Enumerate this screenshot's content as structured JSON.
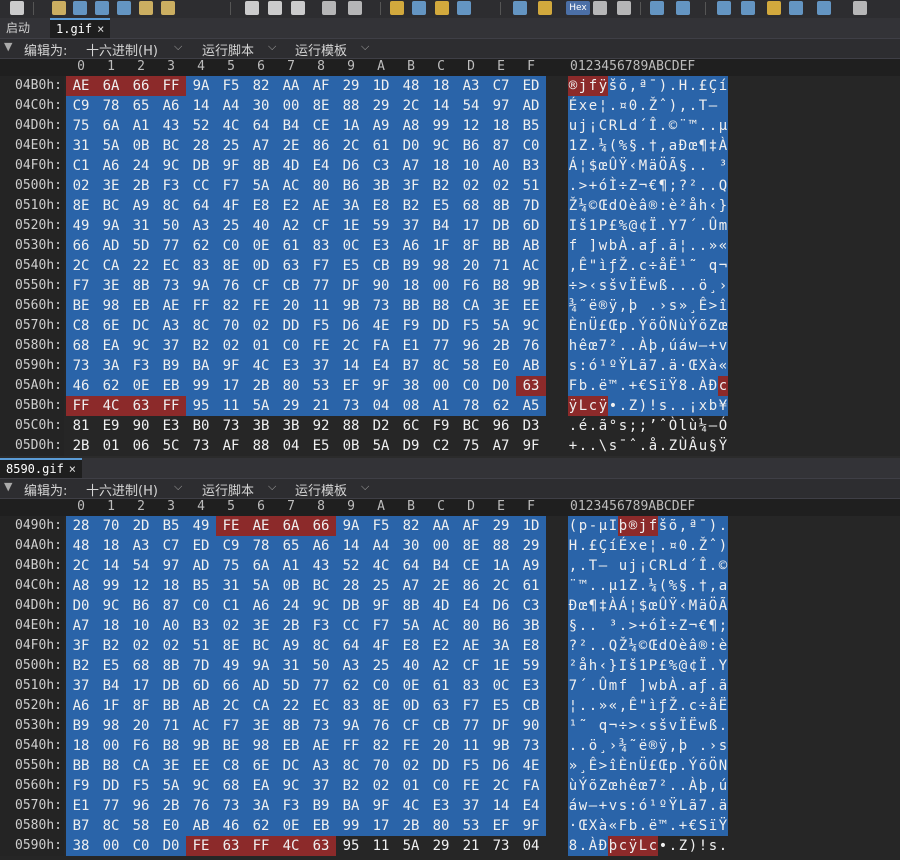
{
  "toolbar": {
    "icons": [
      "new-file-icon",
      "open-folder-icon",
      "save-icon",
      "save-as-icon",
      "save-all-icon",
      "folder-icon",
      "open-multiple-icon",
      "cut-icon",
      "copy-icon",
      "paste-icon",
      "undo-icon",
      "redo-icon",
      "find-icon",
      "replace-icon",
      "find-next-icon",
      "arrow-right-icon",
      "font-icon",
      "highlight-icon",
      "hex-icon",
      "word-wrap-icon",
      "paragraph-icon",
      "list-icon",
      "columns-icon",
      "calculator-icon",
      "settings-icon",
      "tools-icon",
      "chart-icon",
      "convert-icon",
      "expand-icon"
    ],
    "hex_label": "Hex"
  },
  "pane1": {
    "tabs": [
      {
        "label": "启动",
        "active": false
      },
      {
        "label": "1.gif",
        "active": true
      }
    ],
    "close_glyph": "×",
    "toolbar": {
      "edit_as": "编辑为:",
      "edit_mode": "十六进制(H)",
      "run_script": "运行脚本",
      "run_template": "运行模板"
    },
    "col_headers": [
      "0",
      "1",
      "2",
      "3",
      "4",
      "5",
      "6",
      "7",
      "8",
      "9",
      "A",
      "B",
      "C",
      "D",
      "E",
      "F"
    ],
    "ascii_header": "0123456789ABCDEF",
    "rows": [
      {
        "addr": "04B0h:",
        "bytes": [
          "AE",
          "6A",
          "66",
          "FF",
          "9A",
          "F5",
          "82",
          "AA",
          "AF",
          "29",
          "1D",
          "48",
          "18",
          "A3",
          "C7",
          "ED"
        ],
        "ascii": "®jfÿšõ‚ª¯).H.£Çí"
      },
      {
        "addr": "04C0h:",
        "bytes": [
          "C9",
          "78",
          "65",
          "A6",
          "14",
          "A4",
          "30",
          "00",
          "8E",
          "88",
          "29",
          "2C",
          "14",
          "54",
          "97",
          "AD"
        ],
        "ascii": "Éxe¦.¤0.Žˆ),.T—­"
      },
      {
        "addr": "04D0h:",
        "bytes": [
          "75",
          "6A",
          "A1",
          "43",
          "52",
          "4C",
          "64",
          "B4",
          "CE",
          "1A",
          "A9",
          "A8",
          "99",
          "12",
          "18",
          "B5"
        ],
        "ascii": "uj¡CRLd´Î.©¨™..µ"
      },
      {
        "addr": "04E0h:",
        "bytes": [
          "31",
          "5A",
          "0B",
          "BC",
          "28",
          "25",
          "A7",
          "2E",
          "86",
          "2C",
          "61",
          "D0",
          "9C",
          "B6",
          "87",
          "C0"
        ],
        "ascii": "1Z.¼(%§.†,aÐœ¶‡À"
      },
      {
        "addr": "04F0h:",
        "bytes": [
          "C1",
          "A6",
          "24",
          "9C",
          "DB",
          "9F",
          "8B",
          "4D",
          "E4",
          "D6",
          "C3",
          "A7",
          "18",
          "10",
          "A0",
          "B3"
        ],
        "ascii": "Á¦$œÛŸ‹MäÖÃ§.. ³"
      },
      {
        "addr": "0500h:",
        "bytes": [
          "02",
          "3E",
          "2B",
          "F3",
          "CC",
          "F7",
          "5A",
          "AC",
          "80",
          "B6",
          "3B",
          "3F",
          "B2",
          "02",
          "02",
          "51"
        ],
        "ascii": ".>+óÌ÷Z¬€¶;?²..Q"
      },
      {
        "addr": "0510h:",
        "bytes": [
          "8E",
          "BC",
          "A9",
          "8C",
          "64",
          "4F",
          "E8",
          "E2",
          "AE",
          "3A",
          "E8",
          "B2",
          "E5",
          "68",
          "8B",
          "7D"
        ],
        "ascii": "Ž¼©ŒdOèâ®:è²åh‹}"
      },
      {
        "addr": "0520h:",
        "bytes": [
          "49",
          "9A",
          "31",
          "50",
          "A3",
          "25",
          "40",
          "A2",
          "CF",
          "1E",
          "59",
          "37",
          "B4",
          "17",
          "DB",
          "6D"
        ],
        "ascii": "Iš1P£%@¢Ï.Y7´.Ûm"
      },
      {
        "addr": "0530h:",
        "bytes": [
          "66",
          "AD",
          "5D",
          "77",
          "62",
          "C0",
          "0E",
          "61",
          "83",
          "0C",
          "E3",
          "A6",
          "1F",
          "8F",
          "BB",
          "AB"
        ],
        "ascii": "f­]wbÀ.aƒ.ã¦..»«"
      },
      {
        "addr": "0540h:",
        "bytes": [
          "2C",
          "CA",
          "22",
          "EC",
          "83",
          "8E",
          "0D",
          "63",
          "F7",
          "E5",
          "CB",
          "B9",
          "98",
          "20",
          "71",
          "AC"
        ],
        "ascii": ",Ê\"ìƒŽ.c÷åË¹˜ q¬"
      },
      {
        "addr": "0550h:",
        "bytes": [
          "F7",
          "3E",
          "8B",
          "73",
          "9A",
          "76",
          "CF",
          "CB",
          "77",
          "DF",
          "90",
          "18",
          "00",
          "F6",
          "B8",
          "9B"
        ],
        "ascii": "÷>‹sšvÏËwß...ö¸›"
      },
      {
        "addr": "0560h:",
        "bytes": [
          "BE",
          "98",
          "EB",
          "AE",
          "FF",
          "82",
          "FE",
          "20",
          "11",
          "9B",
          "73",
          "BB",
          "B8",
          "CA",
          "3E",
          "EE"
        ],
        "ascii": "¾˜ë®ÿ‚þ .›s»¸Ê>î"
      },
      {
        "addr": "0570h:",
        "bytes": [
          "C8",
          "6E",
          "DC",
          "A3",
          "8C",
          "70",
          "02",
          "DD",
          "F5",
          "D6",
          "4E",
          "F9",
          "DD",
          "F5",
          "5A",
          "9C"
        ],
        "ascii": "ÈnÜ£Œp.ÝõÖNùÝõZœ"
      },
      {
        "addr": "0580h:",
        "bytes": [
          "68",
          "EA",
          "9C",
          "37",
          "B2",
          "02",
          "01",
          "C0",
          "FE",
          "2C",
          "FA",
          "E1",
          "77",
          "96",
          "2B",
          "76"
        ],
        "ascii": "hêœ7²..Àþ,úáw–+v"
      },
      {
        "addr": "0590h:",
        "bytes": [
          "73",
          "3A",
          "F3",
          "B9",
          "BA",
          "9F",
          "4C",
          "E3",
          "37",
          "14",
          "E4",
          "B7",
          "8C",
          "58",
          "E0",
          "AB"
        ],
        "ascii": "s:ó¹ºŸLã7.ä·ŒXà«"
      },
      {
        "addr": "05A0h:",
        "bytes": [
          "46",
          "62",
          "0E",
          "EB",
          "99",
          "17",
          "2B",
          "80",
          "53",
          "EF",
          "9F",
          "38",
          "00",
          "C0",
          "D0",
          "63"
        ],
        "ascii": "Fb.ë™.+€SïŸ8.ÀÐc"
      },
      {
        "addr": "05B0h:",
        "bytes": [
          "FF",
          "4C",
          "63",
          "FF",
          "95",
          "11",
          "5A",
          "29",
          "21",
          "73",
          "04",
          "08",
          "A1",
          "78",
          "62",
          "A5"
        ],
        "ascii": "ÿLcÿ•.Z)!s..¡xb¥"
      },
      {
        "addr": "05C0h:",
        "bytes": [
          "81",
          "E9",
          "90",
          "E3",
          "B0",
          "73",
          "3B",
          "3B",
          "92",
          "88",
          "D2",
          "6C",
          "F9",
          "BC",
          "96",
          "D3"
        ],
        "ascii": ".é.ã°s;;’ˆÒlù¼–Ó"
      },
      {
        "addr": "05D0h:",
        "bytes": [
          "2B",
          "01",
          "06",
          "5C",
          "73",
          "AF",
          "88",
          "04",
          "E5",
          "0B",
          "5A",
          "D9",
          "C2",
          "75",
          "A7",
          "9F"
        ],
        "ascii": "+..\\s¯ˆ.å.ZÙÂu§Ÿ"
      }
    ]
  },
  "pane2": {
    "tabs": [
      {
        "label": "8590.gif",
        "active": true
      }
    ],
    "close_glyph": "×",
    "toolbar": {
      "edit_as": "编辑为:",
      "edit_mode": "十六进制(H)",
      "run_script": "运行脚本",
      "run_template": "运行模板"
    },
    "col_headers": [
      "0",
      "1",
      "2",
      "3",
      "4",
      "5",
      "6",
      "7",
      "8",
      "9",
      "A",
      "B",
      "C",
      "D",
      "E",
      "F"
    ],
    "ascii_header": "0123456789ABCDEF",
    "rows": [
      {
        "addr": "0490h:",
        "bytes": [
          "28",
          "70",
          "2D",
          "B5",
          "49",
          "FE",
          "AE",
          "6A",
          "66",
          "9A",
          "F5",
          "82",
          "AA",
          "AF",
          "29",
          "1D"
        ],
        "ascii": "(p-µIþ®jfšõ‚ª¯)."
      },
      {
        "addr": "04A0h:",
        "bytes": [
          "48",
          "18",
          "A3",
          "C7",
          "ED",
          "C9",
          "78",
          "65",
          "A6",
          "14",
          "A4",
          "30",
          "00",
          "8E",
          "88",
          "29"
        ],
        "ascii": "H.£ÇíÉxe¦.¤0.Žˆ)"
      },
      {
        "addr": "04B0h:",
        "bytes": [
          "2C",
          "14",
          "54",
          "97",
          "AD",
          "75",
          "6A",
          "A1",
          "43",
          "52",
          "4C",
          "64",
          "B4",
          "CE",
          "1A",
          "A9"
        ],
        "ascii": ",.T—­uj¡CRLd´Î.©"
      },
      {
        "addr": "04C0h:",
        "bytes": [
          "A8",
          "99",
          "12",
          "18",
          "B5",
          "31",
          "5A",
          "0B",
          "BC",
          "28",
          "25",
          "A7",
          "2E",
          "86",
          "2C",
          "61"
        ],
        "ascii": "¨™..µ1Z.¼(%§.†,a"
      },
      {
        "addr": "04D0h:",
        "bytes": [
          "D0",
          "9C",
          "B6",
          "87",
          "C0",
          "C1",
          "A6",
          "24",
          "9C",
          "DB",
          "9F",
          "8B",
          "4D",
          "E4",
          "D6",
          "C3"
        ],
        "ascii": "Ðœ¶‡ÀÁ¦$œÛŸ‹MäÖÃ"
      },
      {
        "addr": "04E0h:",
        "bytes": [
          "A7",
          "18",
          "10",
          "A0",
          "B3",
          "02",
          "3E",
          "2B",
          "F3",
          "CC",
          "F7",
          "5A",
          "AC",
          "80",
          "B6",
          "3B"
        ],
        "ascii": "§.. ³.>+óÌ÷Z¬€¶;"
      },
      {
        "addr": "04F0h:",
        "bytes": [
          "3F",
          "B2",
          "02",
          "02",
          "51",
          "8E",
          "BC",
          "A9",
          "8C",
          "64",
          "4F",
          "E8",
          "E2",
          "AE",
          "3A",
          "E8"
        ],
        "ascii": "?²..QŽ¼©ŒdOèâ®:è"
      },
      {
        "addr": "0500h:",
        "bytes": [
          "B2",
          "E5",
          "68",
          "8B",
          "7D",
          "49",
          "9A",
          "31",
          "50",
          "A3",
          "25",
          "40",
          "A2",
          "CF",
          "1E",
          "59"
        ],
        "ascii": "²åh‹}Iš1P£%@¢Ï.Y"
      },
      {
        "addr": "0510h:",
        "bytes": [
          "37",
          "B4",
          "17",
          "DB",
          "6D",
          "66",
          "AD",
          "5D",
          "77",
          "62",
          "C0",
          "0E",
          "61",
          "83",
          "0C",
          "E3"
        ],
        "ascii": "7´.Ûmf­]wbÀ.aƒ.ã"
      },
      {
        "addr": "0520h:",
        "bytes": [
          "A6",
          "1F",
          "8F",
          "BB",
          "AB",
          "2C",
          "CA",
          "22",
          "EC",
          "83",
          "8E",
          "0D",
          "63",
          "F7",
          "E5",
          "CB"
        ],
        "ascii": "¦..»«,Ê\"ìƒŽ.c÷åË"
      },
      {
        "addr": "0530h:",
        "bytes": [
          "B9",
          "98",
          "20",
          "71",
          "AC",
          "F7",
          "3E",
          "8B",
          "73",
          "9A",
          "76",
          "CF",
          "CB",
          "77",
          "DF",
          "90"
        ],
        "ascii": "¹˜ q¬÷>‹sšvÏËwß."
      },
      {
        "addr": "0540h:",
        "bytes": [
          "18",
          "00",
          "F6",
          "B8",
          "9B",
          "BE",
          "98",
          "EB",
          "AE",
          "FF",
          "82",
          "FE",
          "20",
          "11",
          "9B",
          "73"
        ],
        "ascii": "..ö¸›¾˜ë®ÿ‚þ .›s"
      },
      {
        "addr": "0550h:",
        "bytes": [
          "BB",
          "B8",
          "CA",
          "3E",
          "EE",
          "C8",
          "6E",
          "DC",
          "A3",
          "8C",
          "70",
          "02",
          "DD",
          "F5",
          "D6",
          "4E"
        ],
        "ascii": "»¸Ê>îÈnÜ£Œp.ÝõÖN"
      },
      {
        "addr": "0560h:",
        "bytes": [
          "F9",
          "DD",
          "F5",
          "5A",
          "9C",
          "68",
          "EA",
          "9C",
          "37",
          "B2",
          "02",
          "01",
          "C0",
          "FE",
          "2C",
          "FA"
        ],
        "ascii": "ùÝõZœhêœ7²..Àþ,ú"
      },
      {
        "addr": "0570h:",
        "bytes": [
          "E1",
          "77",
          "96",
          "2B",
          "76",
          "73",
          "3A",
          "F3",
          "B9",
          "BA",
          "9F",
          "4C",
          "E3",
          "37",
          "14",
          "E4"
        ],
        "ascii": "áw–+vs:ó¹ºŸLã7.ä"
      },
      {
        "addr": "0580h:",
        "bytes": [
          "B7",
          "8C",
          "58",
          "E0",
          "AB",
          "46",
          "62",
          "0E",
          "EB",
          "99",
          "17",
          "2B",
          "80",
          "53",
          "EF",
          "9F"
        ],
        "ascii": "·ŒXà«Fb.ë™.+€SïŸ"
      },
      {
        "addr": "0590h:",
        "bytes": [
          "38",
          "00",
          "C0",
          "D0",
          "FE",
          "63",
          "FF",
          "4C",
          "63",
          "95",
          "11",
          "5A",
          "29",
          "21",
          "73",
          "04"
        ],
        "ascii": "8.ÀÐþcÿLc•.Z)!s."
      }
    ]
  },
  "colors": {
    "selection": "#2a64a9",
    "highlight": "#8c2a2a",
    "background": "#262626"
  }
}
